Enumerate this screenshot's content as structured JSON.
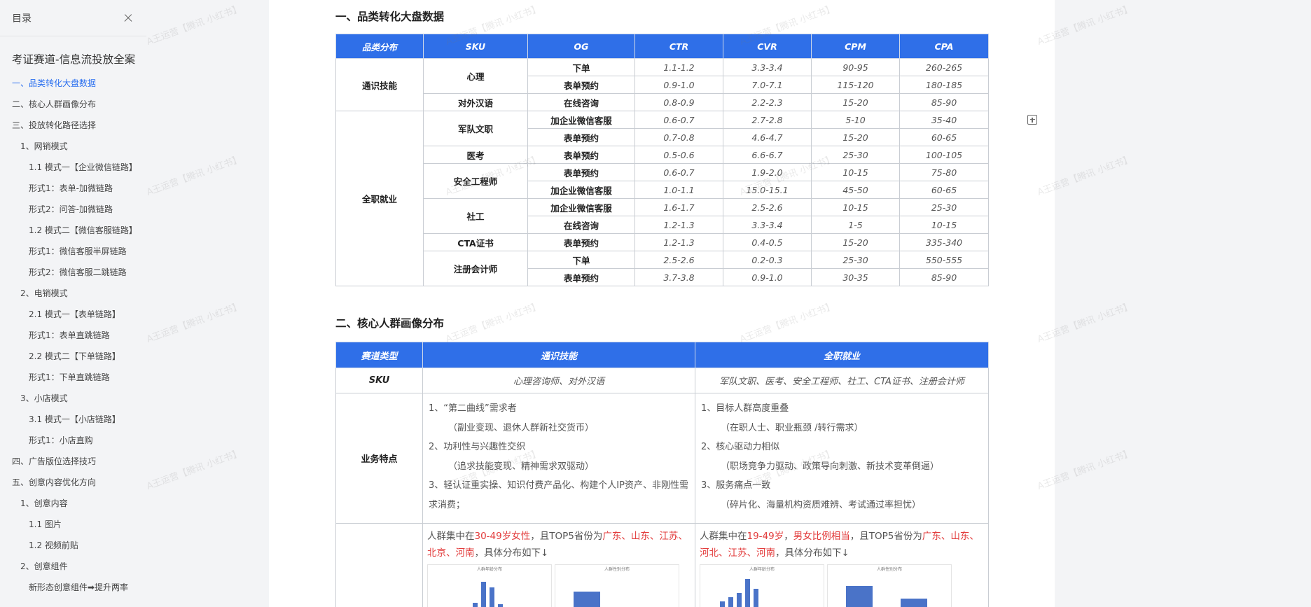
{
  "sidebar": {
    "title": "目录",
    "doc_title": "考证赛道-信息流投放全案",
    "items": [
      {
        "label": "一、品类转化大盘数据",
        "level": 1,
        "active": true
      },
      {
        "label": "二、核心人群画像分布",
        "level": 1
      },
      {
        "label": "三、投放转化路径选择",
        "level": 1
      },
      {
        "label": "1、网销模式",
        "level": 2
      },
      {
        "label": "1.1  模式一【企业微信链路】",
        "level": 3
      },
      {
        "label": "形式1：表单-加微链路",
        "level": 3
      },
      {
        "label": "形式2：问答-加微链路",
        "level": 3
      },
      {
        "label": "1.2  模式二【微信客服链路】",
        "level": 3
      },
      {
        "label": "形式1：微信客服半屏链路",
        "level": 3
      },
      {
        "label": "形式2：微信客服二跳链路",
        "level": 3
      },
      {
        "label": "2、电销模式",
        "level": 2
      },
      {
        "label": "2.1  模式一【表单链路】",
        "level": 3
      },
      {
        "label": "形式1：表单直跳链路",
        "level": 3
      },
      {
        "label": "2.2  模式二【下单链路】",
        "level": 3
      },
      {
        "label": "形式1：下单直跳链路",
        "level": 3
      },
      {
        "label": "3、小店模式",
        "level": 2
      },
      {
        "label": "3.1  模式一【小店链路】",
        "level": 3
      },
      {
        "label": "形式1：小店直购",
        "level": 3
      },
      {
        "label": "四、广告版位选择技巧",
        "level": 1
      },
      {
        "label": "五、创意内容优化方向",
        "level": 1
      },
      {
        "label": "1、创意内容",
        "level": 2
      },
      {
        "label": "1.1  图片",
        "level": 3
      },
      {
        "label": "1.2  视频前贴",
        "level": 3
      },
      {
        "label": "2、创意组件",
        "level": 2
      },
      {
        "label": "新形态创意组件➡提升两率",
        "level": 3
      }
    ]
  },
  "section1": {
    "heading": "一、品类转化大盘数据",
    "headers": [
      "品类分布",
      "SKU",
      "OG",
      "CTR",
      "CVR",
      "CPM",
      "CPA"
    ],
    "groups": {
      "g1": "通识技能",
      "g2": "全职就业"
    },
    "skus": {
      "s1": "心理",
      "s2": "对外汉语",
      "s3": "军队文职",
      "s4": "医考",
      "s5": "安全工程师",
      "s6": "社工",
      "s7": "CTA证书",
      "s8": "注册会计师"
    },
    "rows": [
      {
        "og": "下单",
        "ctr": "1.1-1.2",
        "cvr": "3.3-3.4",
        "cpm": "90-95",
        "cpa": "260-265"
      },
      {
        "og": "表单预约",
        "ctr": "0.9-1.0",
        "cvr": "7.0-7.1",
        "cpm": "115-120",
        "cpa": "180-185"
      },
      {
        "og": "在线咨询",
        "ctr": "0.8-0.9",
        "cvr": "2.2-2.3",
        "cpm": "15-20",
        "cpa": "85-90"
      },
      {
        "og": "加企业微信客服",
        "ctr": "0.6-0.7",
        "cvr": "2.7-2.8",
        "cpm": "5-10",
        "cpa": "35-40"
      },
      {
        "og": "表单预约",
        "ctr": "0.7-0.8",
        "cvr": "4.6-4.7",
        "cpm": "15-20",
        "cpa": "60-65"
      },
      {
        "og": "表单预约",
        "ctr": "0.5-0.6",
        "cvr": "6.6-6.7",
        "cpm": "25-30",
        "cpa": "100-105"
      },
      {
        "og": "表单预约",
        "ctr": "0.6-0.7",
        "cvr": "1.9-2.0",
        "cpm": "10-15",
        "cpa": "75-80"
      },
      {
        "og": "加企业微信客服",
        "ctr": "1.0-1.1",
        "cvr": "15.0-15.1",
        "cpm": "45-50",
        "cpa": "60-65"
      },
      {
        "og": "加企业微信客服",
        "ctr": "1.6-1.7",
        "cvr": "2.5-2.6",
        "cpm": "10-15",
        "cpa": "25-30"
      },
      {
        "og": "在线咨询",
        "ctr": "1.2-1.3",
        "cvr": "3.3-3.4",
        "cpm": "1-5",
        "cpa": "10-15"
      },
      {
        "og": "表单预约",
        "ctr": "1.2-1.3",
        "cvr": "0.4-0.5",
        "cpm": "15-20",
        "cpa": "335-340"
      },
      {
        "og": "下单",
        "ctr": "2.5-2.6",
        "cvr": "0.2-0.3",
        "cpm": "25-30",
        "cpa": "550-555"
      },
      {
        "og": "表单预约",
        "ctr": "3.7-3.8",
        "cvr": "0.9-1.0",
        "cpm": "30-35",
        "cpa": "85-90"
      }
    ]
  },
  "section2": {
    "heading": "二、核心人群画像分布",
    "headers": [
      "赛道类型",
      "通识技能",
      "全职就业"
    ],
    "sku_label": "SKU",
    "sku": {
      "a": "心理咨询师、对外汉语",
      "b": "军队文职、医考、安全工程师、社工、CTA证书、注册会计师"
    },
    "feature_label": "业务特点",
    "features_a": [
      "1、“第二曲线”需求者",
      "（副业变现、退休人群新社交货币）",
      "2、功利性与兴趣性交织",
      "（追求技能变现、精神需求双驱动）",
      "3、轻认证重实操、知识付费产品化、构建个人IP资产、非刚性需求消费；"
    ],
    "features_b": [
      "1、目标人群高度重叠",
      "（在职人士、职业瓶颈 /转行需求）",
      "2、核心驱动力相似",
      "（职场竞争力驱动、政策导向刺激、新技术变革倒逼）",
      "3、服务痛点一致",
      "（碎片化、海量机构资质难辨、考试通过率担忧）"
    ],
    "dist_a": {
      "t1": "人群集中在",
      "r1": "30-49岁女性",
      "t2": "，且TOP5省份为",
      "r2": "广东、山东、江苏、北京、河南",
      "t3": "，具体分布如下↓"
    },
    "dist_b": {
      "t1": "人群集中在",
      "r1": "19-49岁",
      "t2": "，",
      "r2": "男女比例相当",
      "t3": "，且TOP5省份为",
      "r3": "广东、山东、河北、江苏、河南",
      "t4": "，具体分布如下↓"
    },
    "chart_titles": {
      "age": "人群年龄分布",
      "gender": "人群性别分布"
    }
  },
  "watermark": "A王运营【腾讯 小红书】",
  "colors": {
    "accent": "#2f6fe8",
    "highlight": "#e23a3a",
    "bar": "#4a73c8"
  }
}
